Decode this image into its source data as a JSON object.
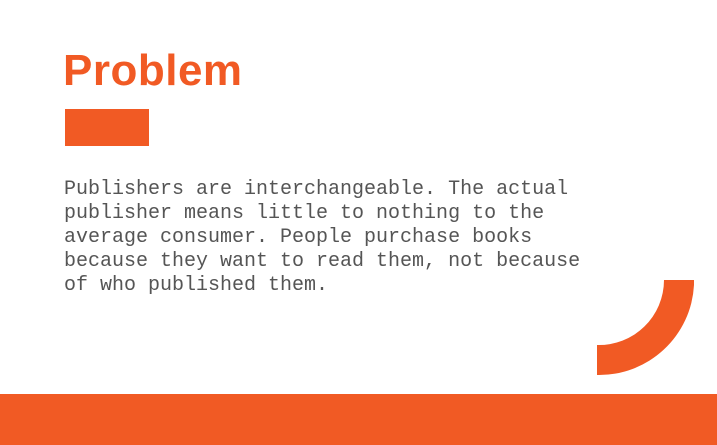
{
  "slide": {
    "title": "Problem",
    "body_lines": [
      "Publishers are interchangeable. The actual",
      "publisher means little to nothing to the",
      "average consumer. People purchase books",
      "because they want to read them, not because",
      "of who published them."
    ]
  },
  "colors": {
    "accent": "#f15a24",
    "text": "#555555",
    "background": "#ffffff"
  }
}
